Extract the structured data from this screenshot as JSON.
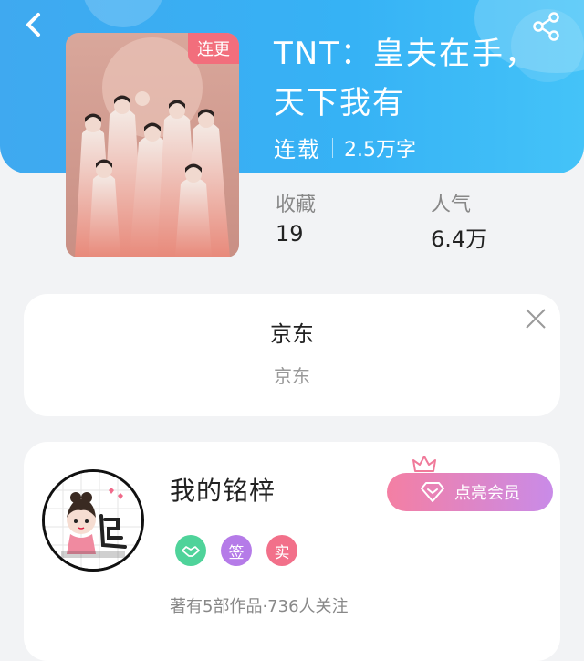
{
  "book": {
    "badge": "连更",
    "title": "TNT：皇夫在手，天下我有",
    "status": "连载",
    "word_count": "2.5万字",
    "collect_label": "收藏",
    "collect_value": "19",
    "popularity_label": "人气",
    "popularity_value": "6.4万"
  },
  "store": {
    "name": "京东",
    "subtitle": "京东"
  },
  "author": {
    "name": "我的铭梓",
    "vip_button": "点亮会员",
    "badge_sign": "签",
    "badge_real": "实",
    "stats": "著有5部作品·736人关注"
  },
  "colors": {
    "header": "#3fa9f0",
    "badge": "#f26e7c",
    "vip_start": "#f47fa3",
    "vip_end": "#c98be8",
    "badge_green": "#4fd39a",
    "badge_purple": "#b57be8",
    "badge_red": "#f2708a"
  },
  "icons": [
    "back-arrow-icon",
    "share-icon",
    "close-icon",
    "handshake-icon",
    "crown-icon",
    "diamond-icon"
  ]
}
